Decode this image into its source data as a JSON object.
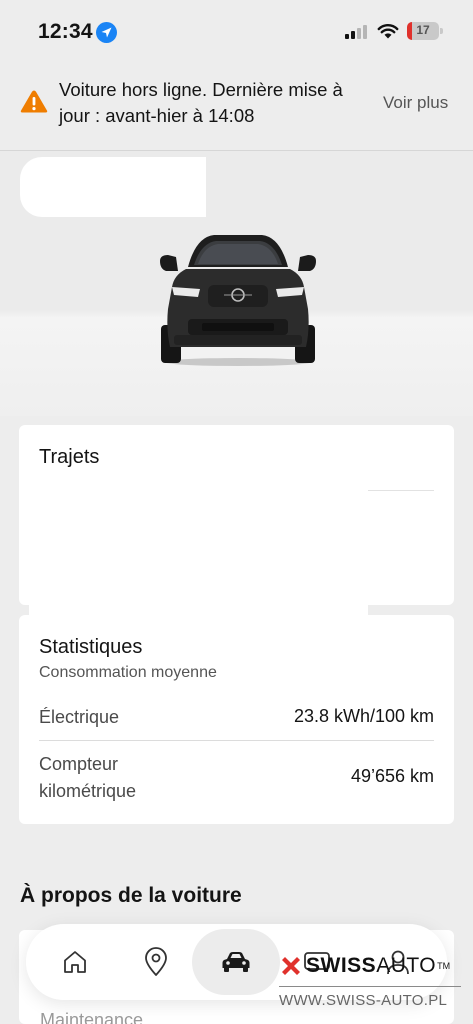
{
  "status_bar": {
    "time": "12:34",
    "battery": "17",
    "battery_color": "#e0312c",
    "location_color": "#1a84f5"
  },
  "banner": {
    "message": "Voiture hors ligne. Dernière mise à jour : avant-hier à 14:08",
    "action": "Voir plus",
    "icon": "warning-triangle-icon",
    "icon_color": "#ef7d00"
  },
  "trips": {
    "title": "Trajets"
  },
  "stats": {
    "title": "Statistiques",
    "subtitle": "Consommation moyenne",
    "rows": [
      {
        "label": "Électrique",
        "value": "23.8 kWh/100 km"
      },
      {
        "label": "Compteur kilométrique",
        "value": "49’656 km"
      }
    ]
  },
  "about": {
    "title": "À propos de la voiture",
    "partial_item": "Maintenance"
  },
  "tabbar": {
    "items": [
      {
        "name": "home",
        "icon": "home-icon"
      },
      {
        "name": "map",
        "icon": "location-pin-icon"
      },
      {
        "name": "car",
        "icon": "car-icon",
        "active": true
      },
      {
        "name": "messages",
        "icon": "message-icon"
      },
      {
        "name": "profile",
        "icon": "person-icon"
      }
    ]
  },
  "watermark": {
    "brand_bold": "SWISS",
    "brand_light": "AUTO",
    "tm": "TM",
    "url": "WWW.SWISS-AUTO.PL",
    "accent": "#e0312c"
  }
}
